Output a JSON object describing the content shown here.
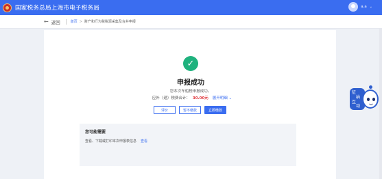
{
  "header": {
    "title": "国家税务总局上海市电子税务局",
    "user_name": "a.a",
    "caret": "⌄"
  },
  "nav": {
    "back_label": "返回",
    "breadcrumb_home": "首页",
    "breadcrumb_sep": ">",
    "breadcrumb_current": "财产和行为税税源采集及合并申报"
  },
  "result": {
    "check_glyph": "✓",
    "title": "申报成功",
    "notice": "您本次车船税申报成功。",
    "tax_label": "应补（退）税费合计：",
    "tax_amount": "30.00元",
    "detail_link": "展开明细 ⌄"
  },
  "buttons": {
    "evaluate": "评价",
    "pay_later": "暂不缴款",
    "pay_now": "立即缴款"
  },
  "maybe_need": {
    "title": "您可能需要",
    "text": "查看、下载或打印本次申报表信息",
    "link": "查看"
  },
  "assistant": {
    "chars": [
      "征",
      "纳",
      "互",
      "动"
    ]
  }
}
